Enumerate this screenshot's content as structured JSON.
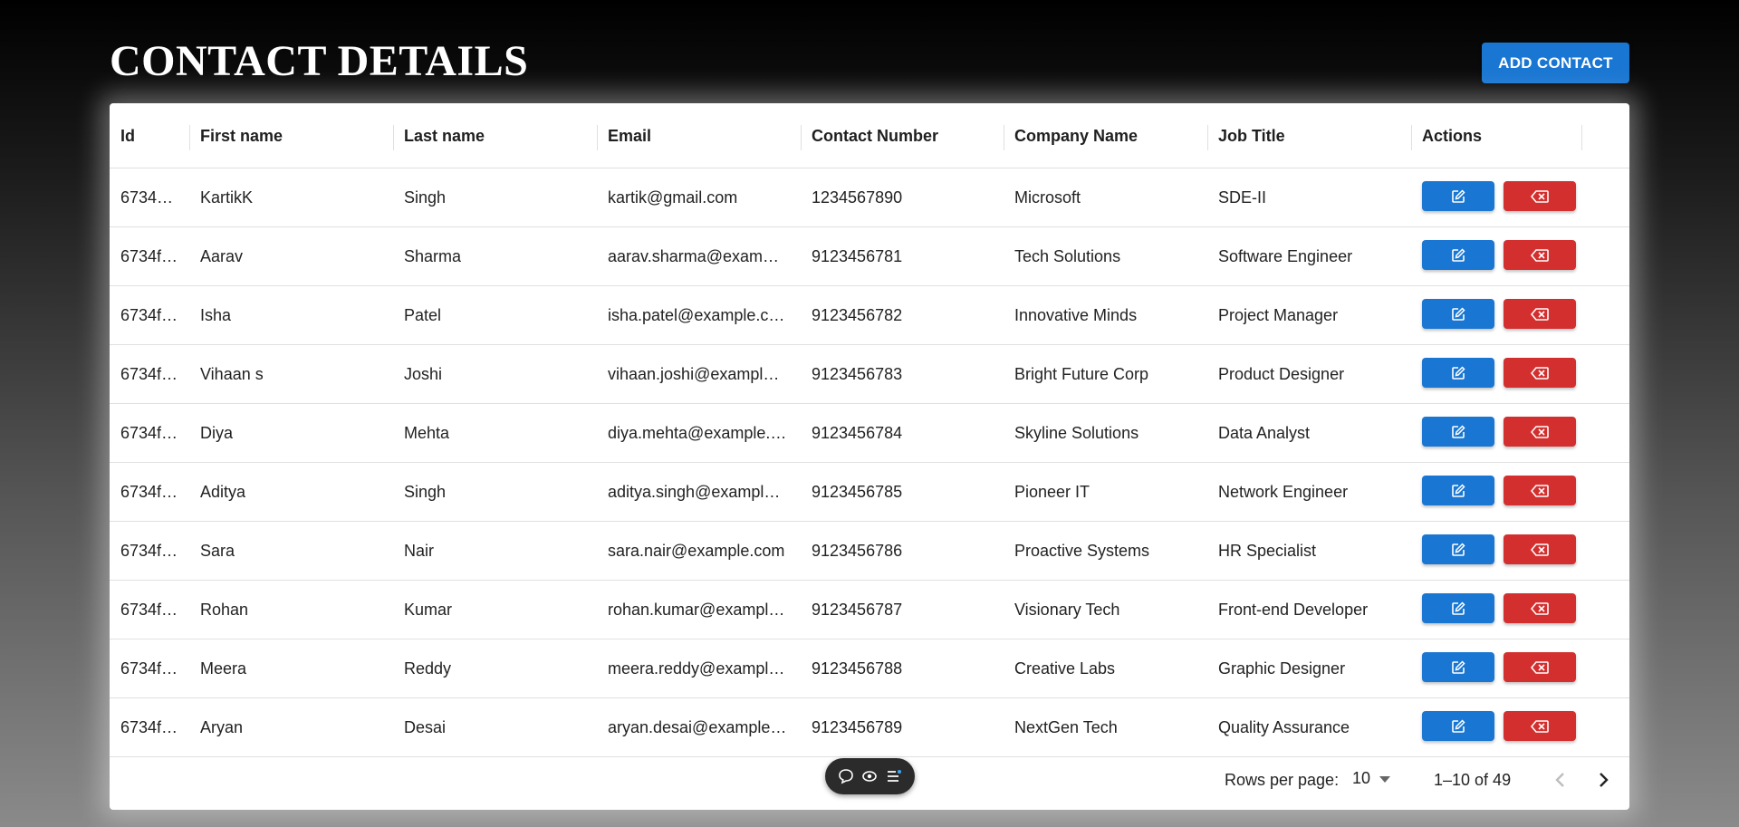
{
  "header": {
    "title": "CONTACT DETAILS",
    "add_button_label": "ADD CONTACT"
  },
  "table": {
    "columns": [
      "Id",
      "First name",
      "Last name",
      "Email",
      "Contact Number",
      "Company Name",
      "Job Title",
      "Actions"
    ],
    "rows": [
      [
        "6734e…",
        "KartikK",
        "Singh",
        "kartik@gmail.com",
        "1234567890",
        "Microsoft",
        "SDE-II"
      ],
      [
        "6734f…",
        "Aarav",
        "Sharma",
        "aarav.sharma@exampl…",
        "9123456781",
        "Tech Solutions",
        "Software Engineer"
      ],
      [
        "6734f…",
        "Isha",
        "Patel",
        "isha.patel@example.co…",
        "9123456782",
        "Innovative Minds",
        "Project Manager"
      ],
      [
        "6734f…",
        "Vihaan s",
        "Joshi",
        "vihaan.joshi@example.…",
        "9123456783",
        "Bright Future Corp",
        "Product Designer"
      ],
      [
        "6734f…",
        "Diya",
        "Mehta",
        "diya.mehta@example.c…",
        "9123456784",
        "Skyline Solutions",
        "Data Analyst"
      ],
      [
        "6734f…",
        "Aditya",
        "Singh",
        "aditya.singh@example.…",
        "9123456785",
        "Pioneer IT",
        "Network Engineer"
      ],
      [
        "6734f…",
        "Sara",
        "Nair",
        "sara.nair@example.com",
        "9123456786",
        "Proactive Systems",
        "HR Specialist"
      ],
      [
        "6734f…",
        "Rohan",
        "Kumar",
        "rohan.kumar@example…",
        "9123456787",
        "Visionary Tech",
        "Front-end Developer"
      ],
      [
        "6734f…",
        "Meera",
        "Reddy",
        "meera.reddy@example.…",
        "9123456788",
        "Creative Labs",
        "Graphic Designer"
      ],
      [
        "6734f…",
        "Aryan",
        "Desai",
        "aryan.desai@example.…",
        "9123456789",
        "NextGen Tech",
        "Quality Assurance"
      ]
    ],
    "action_icons": [
      "edit-icon",
      "backspace-delete-icon"
    ]
  },
  "footer": {
    "rows_per_page_label": "Rows per page:",
    "rows_per_page_value": "10",
    "range_text": "1–10 of 49"
  },
  "toolbar_icons": [
    "comment-icon",
    "eye-icon",
    "list-icon"
  ],
  "colors": {
    "primary": "#1976d2",
    "danger": "#d32f2f"
  }
}
